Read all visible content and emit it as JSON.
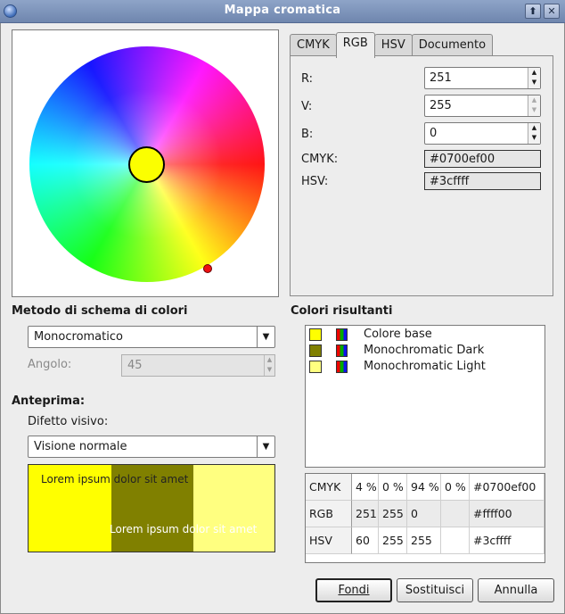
{
  "window": {
    "title": "Mappa cromatica"
  },
  "tabs": [
    "CMYK",
    "RGB",
    "HSV",
    "Documento"
  ],
  "rgb_panel": {
    "r_label": "R:",
    "r_value": "251",
    "v_label": "V:",
    "v_value": "255",
    "b_label": "B:",
    "b_value": "0",
    "cmyk_label": "CMYK:",
    "cmyk_value": "#0700ef00",
    "hsv_label": "HSV:",
    "hsv_value": "#3cffff"
  },
  "scheme": {
    "title": "Metodo di schema di colori",
    "method_value": "Monocromatico",
    "angle_label": "Angolo:",
    "angle_value": "45"
  },
  "preview": {
    "title": "Anteprima:",
    "defect_label": "Difetto visivo:",
    "defect_value": "Visione normale",
    "sample_text_top": "Lorem ipsum dolor sit amet",
    "sample_text_bottom": "Lorem ipsum dolor sit amet",
    "colors": [
      "#ffff00",
      "#808000",
      "#ffff80"
    ]
  },
  "results": {
    "title": "Colori risultanti",
    "items": [
      {
        "label": "Colore base",
        "color": "#ffff00"
      },
      {
        "label": "Monochromatic Dark",
        "color": "#808000"
      },
      {
        "label": "Monochromatic Light",
        "color": "#ffff80"
      }
    ]
  },
  "table": {
    "rows": [
      {
        "h": "CMYK",
        "c1": "4 %",
        "c2": "0 %",
        "c3": "94 %",
        "c4": "0 %",
        "c5": "#0700ef00"
      },
      {
        "h": "RGB",
        "c1": "251",
        "c2": "255",
        "c3": "0",
        "c4": "",
        "c5": "#ffff00"
      },
      {
        "h": "HSV",
        "c1": "60",
        "c2": "255",
        "c3": "255",
        "c4": "",
        "c5": "#3cffff"
      }
    ]
  },
  "buttons": {
    "merge": "Fondi",
    "replace": "Sostituisci",
    "cancel": "Annulla"
  },
  "titlebar_buttons": {
    "up": "⬆",
    "close": "✕"
  }
}
